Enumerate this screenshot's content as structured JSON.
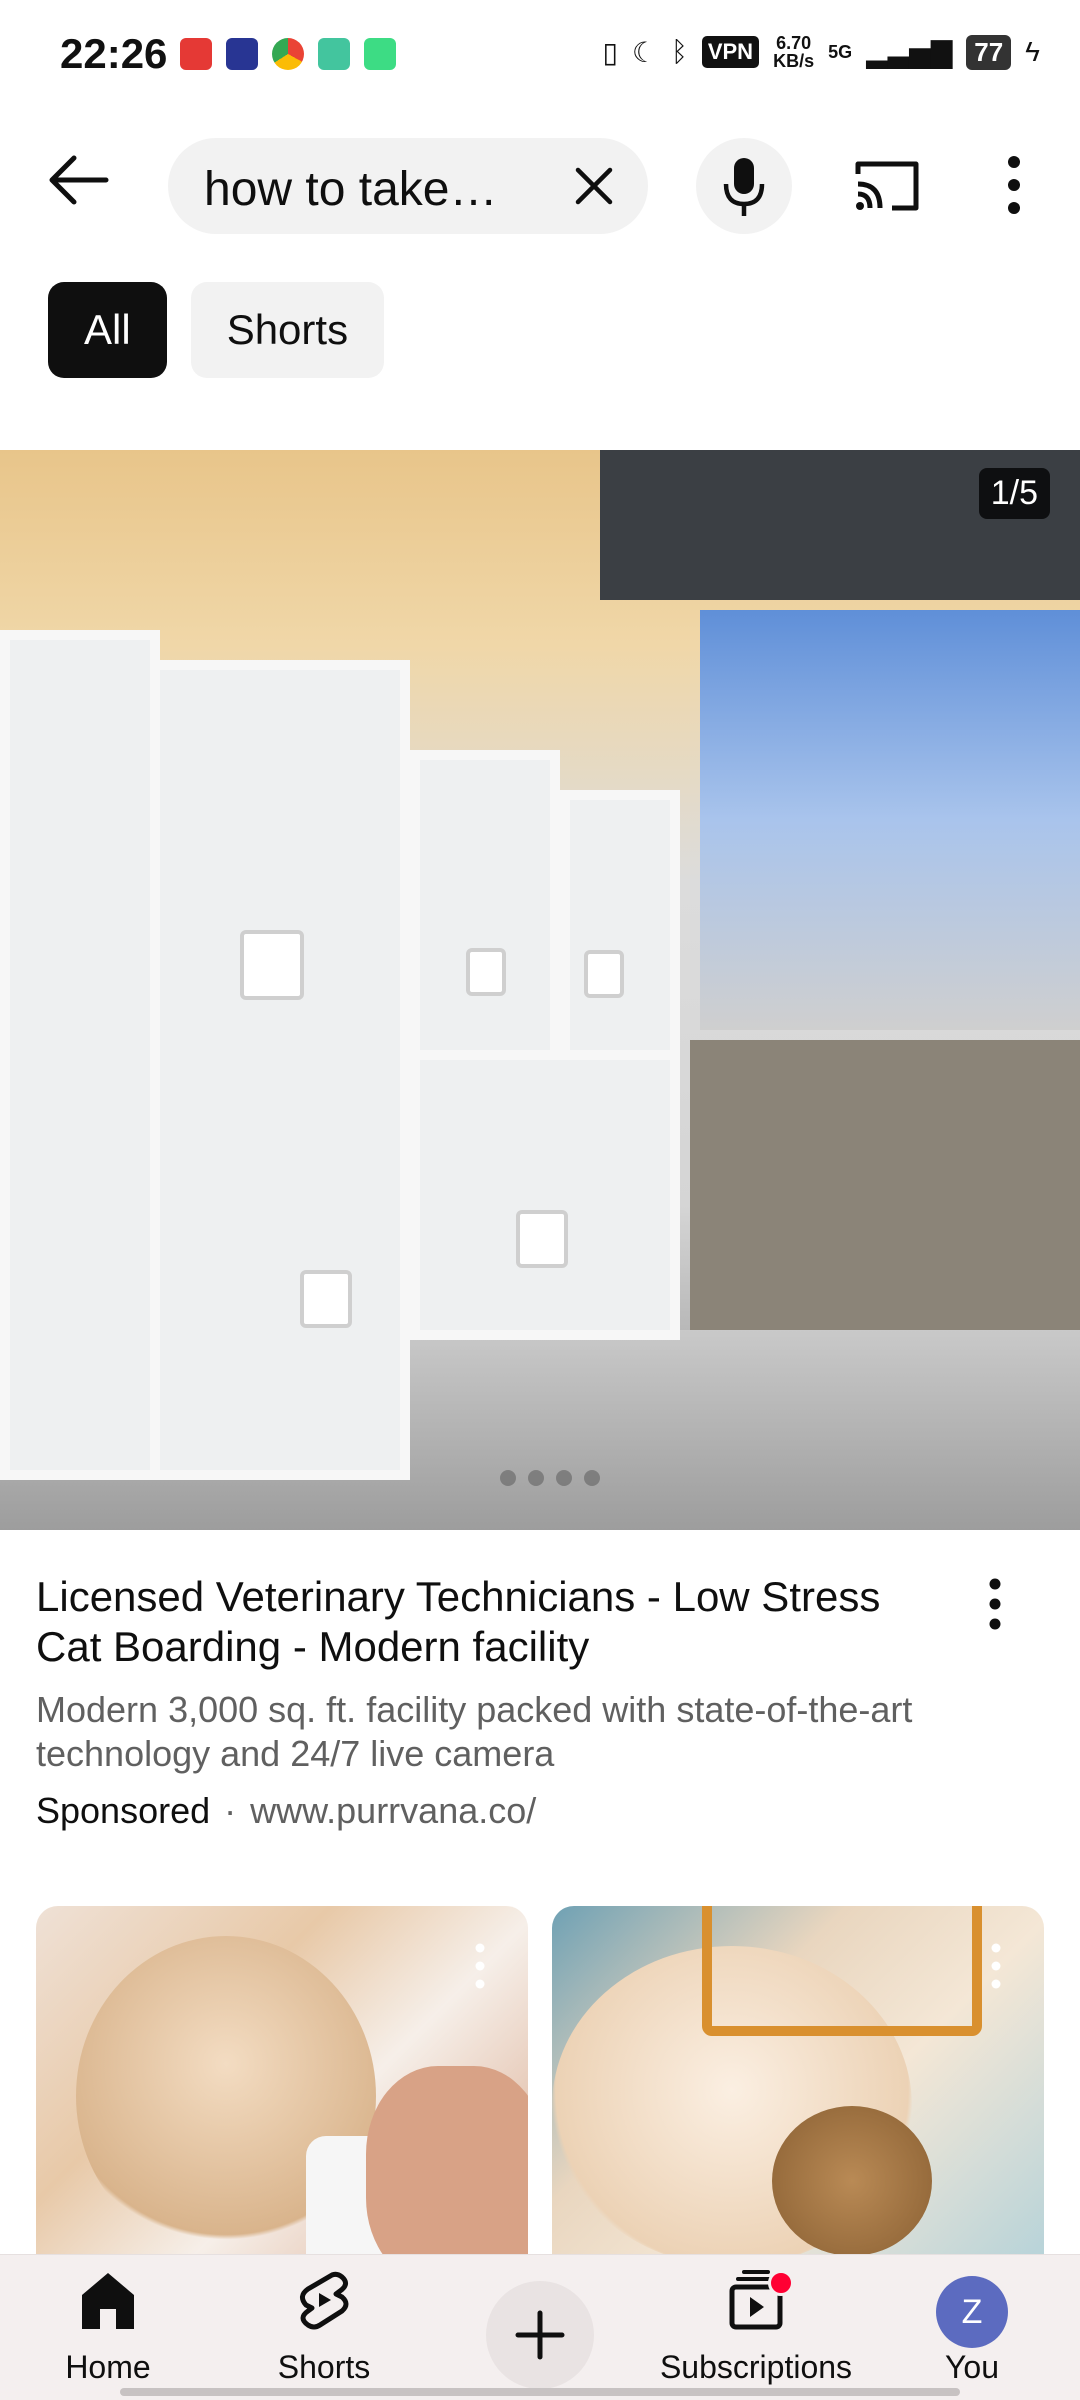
{
  "status_bar": {
    "time": "22:26",
    "vpn": "VPN",
    "net_speed": "6.70\nKB/s",
    "network": "5G",
    "battery": "77"
  },
  "search": {
    "query": "how to take…",
    "icons": {
      "back": "arrow-left-icon",
      "clear": "close-icon",
      "mic": "microphone-icon",
      "cast": "cast-icon",
      "more": "more-vert-icon"
    }
  },
  "chips": [
    {
      "label": "All",
      "active": true
    },
    {
      "label": "Shorts",
      "active": false
    }
  ],
  "ad": {
    "counter": "1/5",
    "title": "Licensed Veterinary Technicians - Low Stress Cat Boarding - Modern facility",
    "description": "Modern 3,000 sq. ft. facility packed with state-of-the-art technology and 24/7 live camera",
    "sponsored": "Sponsored",
    "separator": "·",
    "url": "www.purrvana.co/"
  },
  "shorts": [
    {
      "thumb": "kitten-drinking-milk"
    },
    {
      "thumb": "kitten-being-brushed"
    }
  ],
  "bottom_nav": {
    "home": "Home",
    "shorts": "Shorts",
    "subscriptions": "Subscriptions",
    "you": "You",
    "avatar_initial": "Z"
  },
  "colors": {
    "chip_active": "#0f0f0f",
    "notification_dot": "#ff0033",
    "avatar": "#5c6bc0"
  }
}
